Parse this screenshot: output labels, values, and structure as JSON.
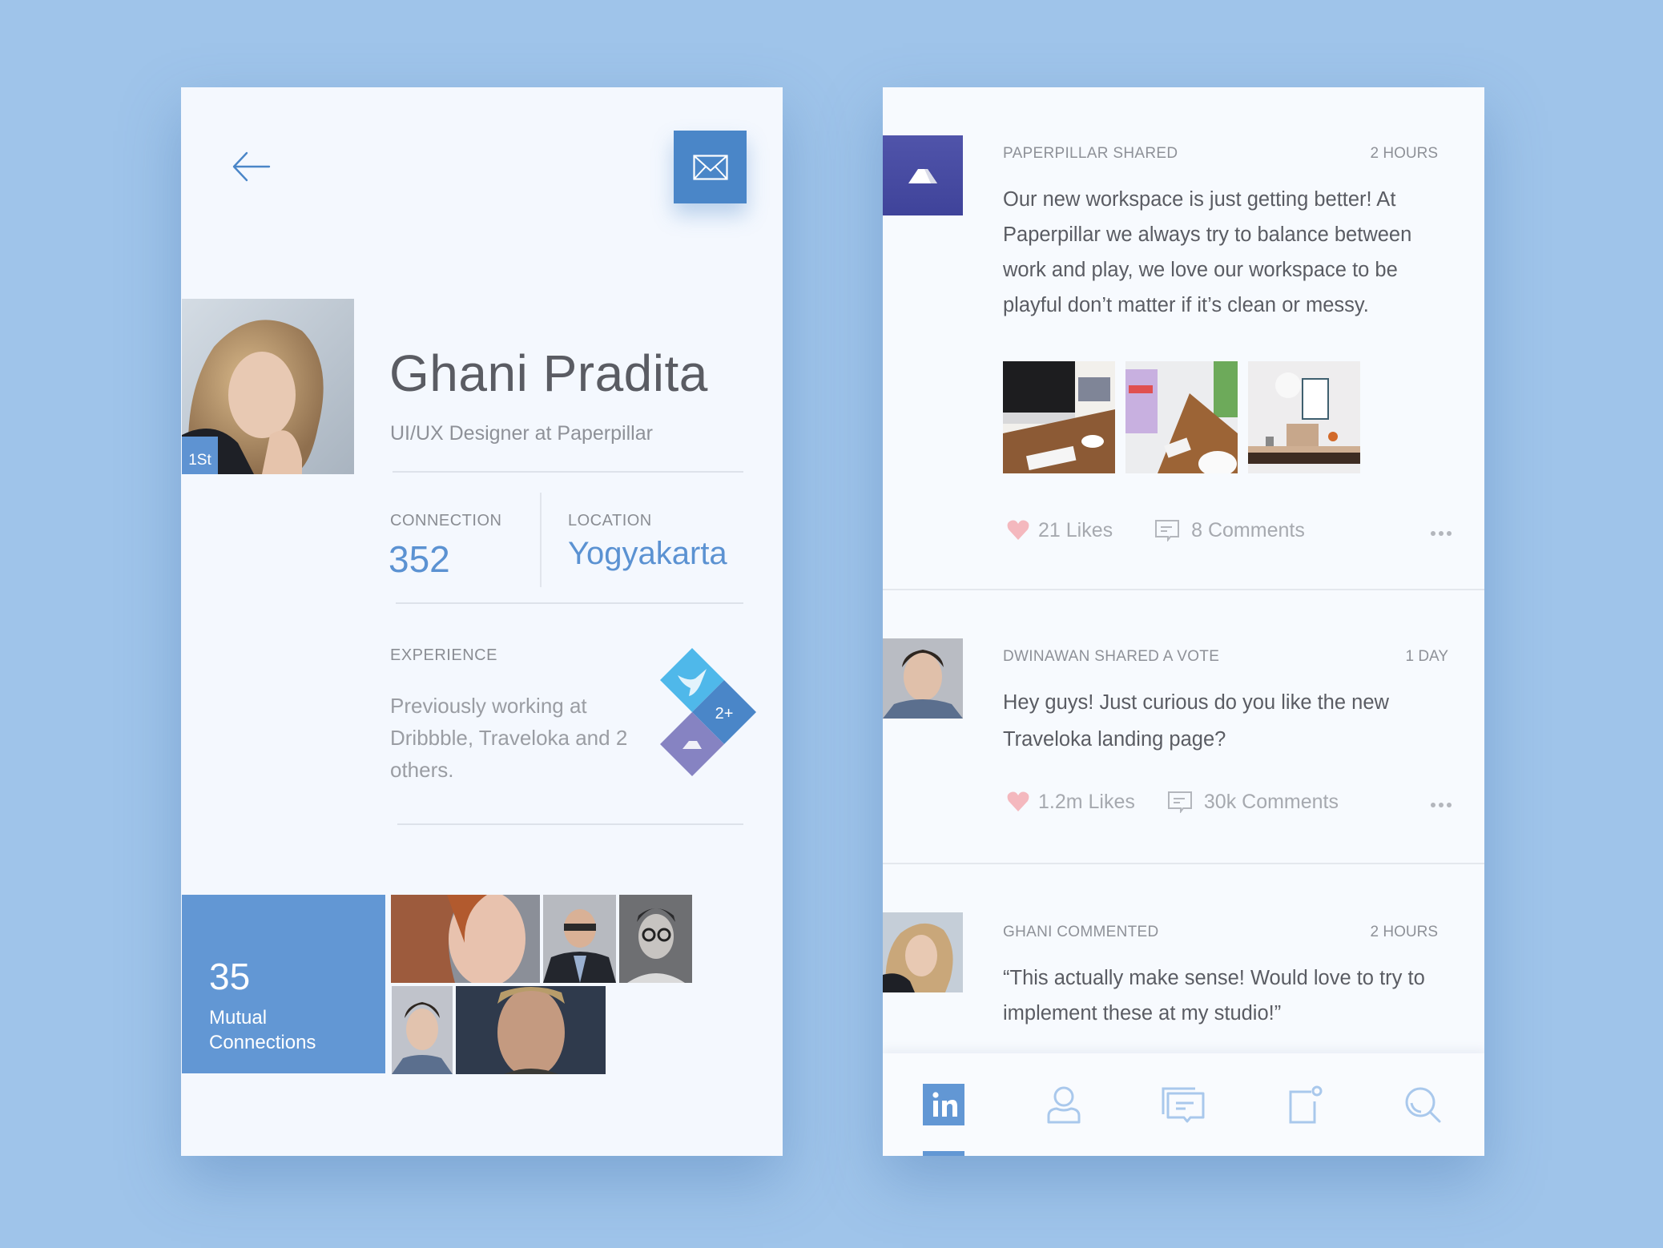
{
  "profile": {
    "back_icon": "arrow-left-icon",
    "message_icon": "envelope-icon",
    "degree_badge": "1St",
    "name": "Ghani Pradita",
    "headline": "UI/UX Designer at Paperpillar",
    "connection_label": "CONNECTION",
    "connection_value": "352",
    "location_label": "LOCATION",
    "location_value": "Yogyakarta",
    "experience_label": "EXPERIENCE",
    "experience_text": "Previously working at Dribbble, Traveloka and 2 others.",
    "experience_more": "2+",
    "mutual_count": "35",
    "mutual_label_line1": "Mutual",
    "mutual_label_line2": "Connections"
  },
  "colors": {
    "background": "#9FC4EA",
    "accent": "#4A86C8",
    "accent_light": "#6297D4",
    "traveloka": "#4FB8EA",
    "paperpillar": "#4E50A8",
    "like": "#F4B8BE"
  },
  "feed": {
    "posts": [
      {
        "actor": "PAPERPILLAR SHARED",
        "time": "2 HOURS",
        "text": "Our new workspace is just getting better! At Paperpillar we always try to balance between work and play, we love our workspace to be playful don’t matter if it’s clean or messy.",
        "likes": "21 Likes",
        "comments": "8 Comments"
      },
      {
        "actor": "DWINAWAN SHARED A VOTE",
        "time": "1 DAY",
        "text": "Hey guys! Just curious do you like the new Traveloka landing page?",
        "likes": "1.2m Likes",
        "comments": "30k Comments"
      },
      {
        "actor": "GHANI COMMENTED",
        "time": "2 HOURS",
        "text": "“This actually make sense! Would love to try to implement these at my studio!”"
      }
    ]
  },
  "nav": {
    "items": [
      {
        "icon": "linkedin-home-icon",
        "active": true
      },
      {
        "icon": "profile-icon",
        "active": false
      },
      {
        "icon": "messages-icon",
        "active": false
      },
      {
        "icon": "notifications-icon",
        "active": false
      },
      {
        "icon": "search-icon",
        "active": false
      }
    ]
  }
}
